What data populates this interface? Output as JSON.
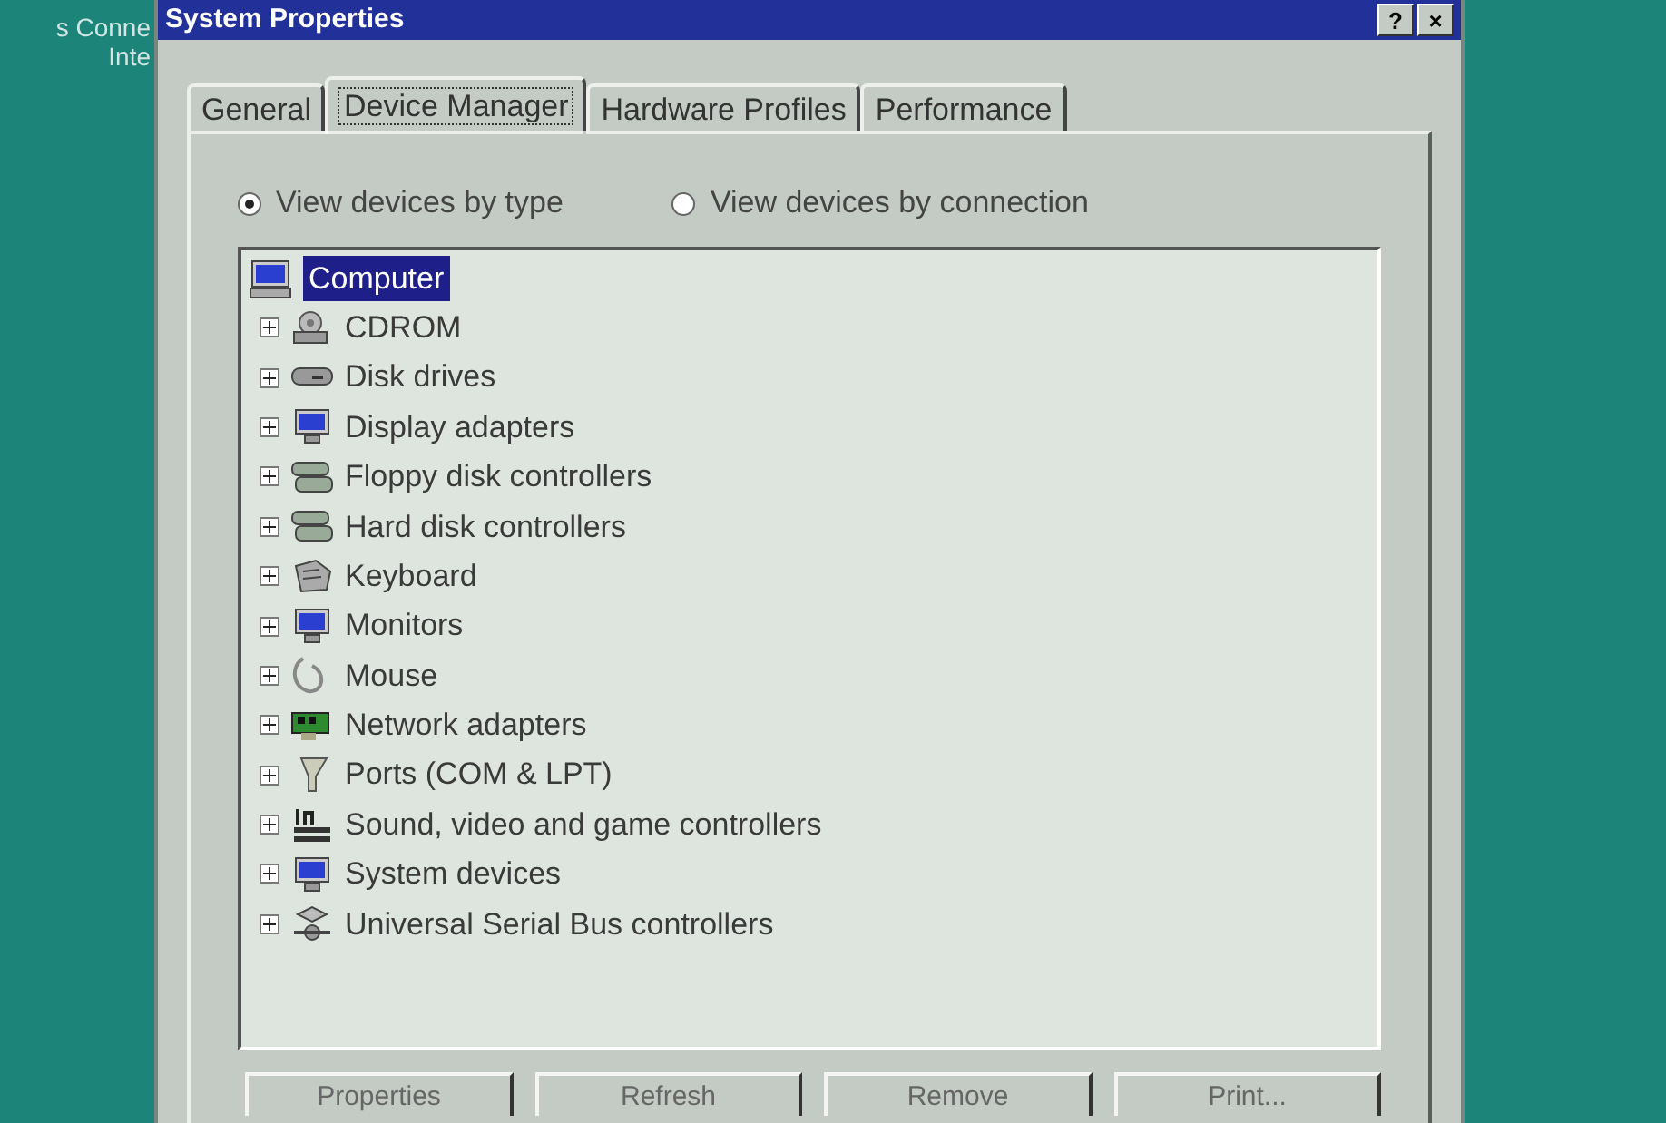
{
  "desktop": {
    "icon_labels": [
      "s Conne",
      "Inte"
    ]
  },
  "window": {
    "title": "System Properties",
    "title_buttons": [
      "?",
      "×"
    ]
  },
  "tabs": [
    {
      "label": "General",
      "selected": false
    },
    {
      "label": "Device Manager",
      "selected": true
    },
    {
      "label": "Hardware Profiles",
      "selected": false
    },
    {
      "label": "Performance",
      "selected": false
    }
  ],
  "view_options": [
    {
      "label": "View devices by type",
      "selected": true
    },
    {
      "label": "View devices by connection",
      "selected": false
    }
  ],
  "tree": {
    "label": "Computer",
    "selected": true,
    "children": [
      {
        "label": "CDROM",
        "expanded": false
      },
      {
        "label": "Disk drives",
        "expanded": false
      },
      {
        "label": "Display adapters",
        "expanded": false
      },
      {
        "label": "Floppy disk controllers",
        "expanded": false
      },
      {
        "label": "Hard disk controllers",
        "expanded": false
      },
      {
        "label": "Keyboard",
        "expanded": false
      },
      {
        "label": "Monitors",
        "expanded": false
      },
      {
        "label": "Mouse",
        "expanded": false
      },
      {
        "label": "Network adapters",
        "expanded": false
      },
      {
        "label": "Ports (COM & LPT)",
        "expanded": false
      },
      {
        "label": "Sound, video and game controllers",
        "expanded": false
      },
      {
        "label": "System devices",
        "expanded": false
      },
      {
        "label": "Universal Serial Bus controllers",
        "expanded": false
      }
    ]
  },
  "buttons": [
    "Properties",
    "Refresh",
    "Remove",
    "Print..."
  ]
}
